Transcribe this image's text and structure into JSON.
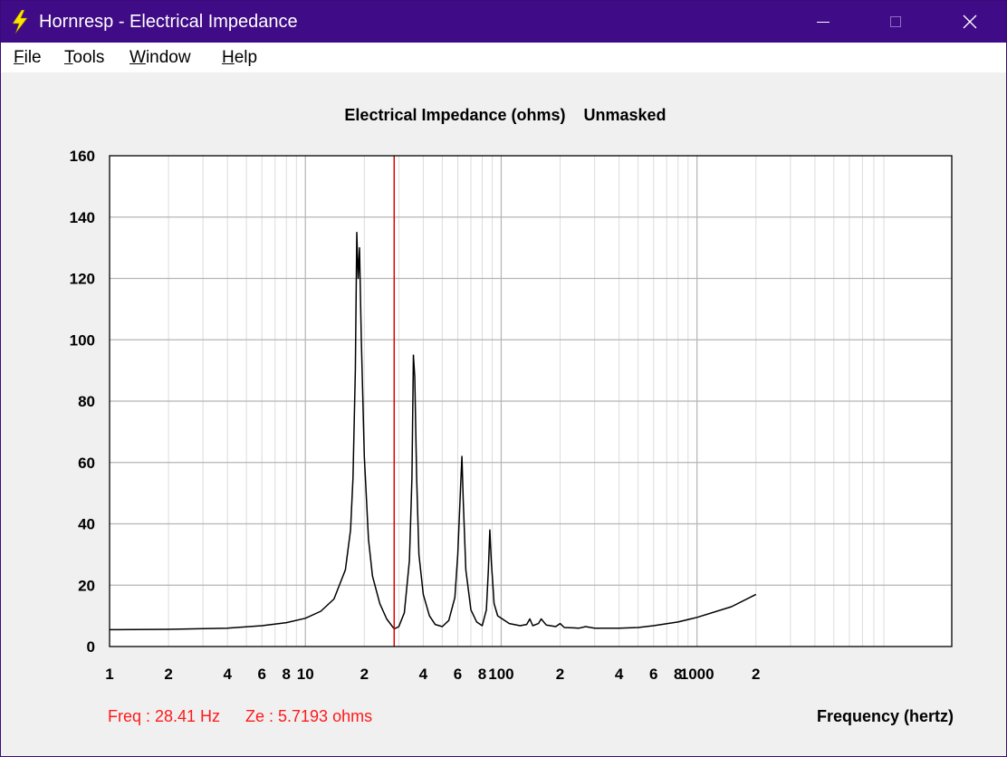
{
  "window": {
    "title": "Hornresp - Electrical Impedance",
    "colors": {
      "titlebar": "#3f0b86",
      "accent_icon": "#ffe400"
    },
    "controls": [
      "minimize-icon",
      "maximize-icon",
      "close-icon"
    ]
  },
  "menu": {
    "items": [
      {
        "accel": "F",
        "rest": "ile"
      },
      {
        "accel": "T",
        "rest": "ools"
      },
      {
        "accel": "W",
        "rest": "indow"
      },
      {
        "accel": "H",
        "rest": "elp"
      }
    ]
  },
  "chart_data": {
    "type": "line",
    "title": "Electrical Impedance (ohms)",
    "mask_status": "Unmasked",
    "xlabel": "Frequency (hertz)",
    "xscale": "log",
    "xlim": [
      1,
      20000
    ],
    "ylim": [
      0,
      160
    ],
    "yticks": [
      "0",
      "20",
      "40",
      "60",
      "80",
      "100",
      "120",
      "140",
      "160"
    ],
    "xtick_labels": [
      {
        "value": 1,
        "label": "1"
      },
      {
        "value": 2,
        "label": "2"
      },
      {
        "value": 4,
        "label": "4"
      },
      {
        "value": 6,
        "label": "6"
      },
      {
        "value": 8,
        "label": "8"
      },
      {
        "value": 10,
        "label": "10"
      },
      {
        "value": 20,
        "label": "2"
      },
      {
        "value": 40,
        "label": "4"
      },
      {
        "value": 60,
        "label": "6"
      },
      {
        "value": 80,
        "label": "8"
      },
      {
        "value": 100,
        "label": "100"
      },
      {
        "value": 200,
        "label": "2"
      },
      {
        "value": 400,
        "label": "4"
      },
      {
        "value": 600,
        "label": "6"
      },
      {
        "value": 800,
        "label": "8"
      },
      {
        "value": 1000,
        "label": "1000"
      },
      {
        "value": 2000,
        "label": "2"
      }
    ],
    "grid": true,
    "cursor": {
      "freq_hz": 28.41,
      "color": "#e00000"
    },
    "series": [
      {
        "color": "#000000",
        "points": [
          [
            1,
            5.5
          ],
          [
            2,
            5.6
          ],
          [
            4,
            6.0
          ],
          [
            6,
            6.8
          ],
          [
            8,
            7.8
          ],
          [
            10,
            9.2
          ],
          [
            12,
            11.5
          ],
          [
            14,
            15.5
          ],
          [
            16,
            25
          ],
          [
            17,
            38
          ],
          [
            17.5,
            55
          ],
          [
            18,
            90
          ],
          [
            18.3,
            135
          ],
          [
            18.6,
            120
          ],
          [
            18.9,
            130
          ],
          [
            19.3,
            100
          ],
          [
            20,
            62
          ],
          [
            21,
            35
          ],
          [
            22,
            23
          ],
          [
            24,
            14
          ],
          [
            26,
            9
          ],
          [
            28.41,
            5.72
          ],
          [
            30,
            6.5
          ],
          [
            32,
            11
          ],
          [
            34,
            28
          ],
          [
            35,
            55
          ],
          [
            35.6,
            95
          ],
          [
            36.2,
            88
          ],
          [
            37,
            55
          ],
          [
            38,
            30
          ],
          [
            40,
            17
          ],
          [
            43,
            10
          ],
          [
            46,
            7.2
          ],
          [
            50,
            6.5
          ],
          [
            54,
            8.5
          ],
          [
            58,
            16
          ],
          [
            60,
            30
          ],
          [
            62,
            52
          ],
          [
            63,
            62
          ],
          [
            64,
            48
          ],
          [
            66,
            25
          ],
          [
            70,
            12
          ],
          [
            75,
            8
          ],
          [
            80,
            6.8
          ],
          [
            84,
            12
          ],
          [
            86,
            25
          ],
          [
            87.5,
            38
          ],
          [
            89,
            28
          ],
          [
            92,
            14
          ],
          [
            96,
            10
          ],
          [
            110,
            7.5
          ],
          [
            125,
            6.8
          ],
          [
            135,
            7.2
          ],
          [
            140,
            9
          ],
          [
            145,
            6.8
          ],
          [
            155,
            7.5
          ],
          [
            160,
            9
          ],
          [
            170,
            7
          ],
          [
            190,
            6.5
          ],
          [
            200,
            7.5
          ],
          [
            210,
            6.2
          ],
          [
            250,
            6
          ],
          [
            270,
            6.5
          ],
          [
            300,
            6
          ],
          [
            400,
            6
          ],
          [
            500,
            6.2
          ],
          [
            600,
            6.8
          ],
          [
            800,
            8
          ],
          [
            1000,
            9.5
          ],
          [
            1500,
            13
          ],
          [
            2000,
            17
          ]
        ]
      }
    ]
  },
  "status": {
    "freq": "Freq : 28.41 Hz",
    "ze": "Ze : 5.7193 ohms",
    "color": "#ff1a1a"
  }
}
